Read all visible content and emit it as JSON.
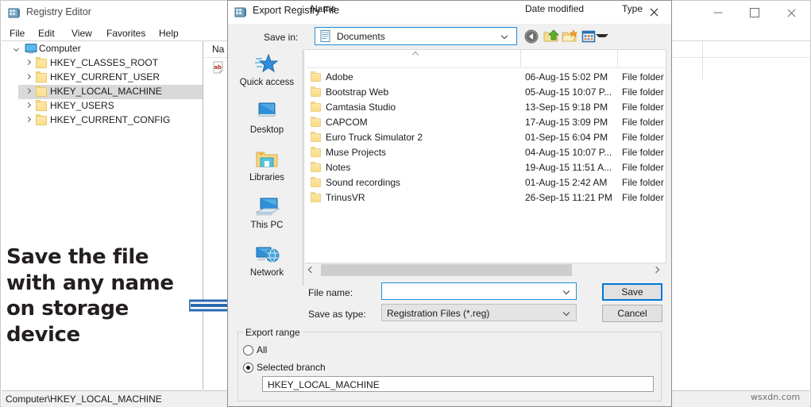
{
  "registry_editor": {
    "title": "Registry Editor",
    "title_icon": "registry-editor-icon",
    "window_controls": {
      "minimize": "minimize-icon",
      "maximize": "maximize-icon",
      "close": "close-icon"
    },
    "menu": [
      "File",
      "Edit",
      "View",
      "Favorites",
      "Help"
    ],
    "tree": {
      "root": {
        "label": "Computer",
        "icon": "computer-icon",
        "expanded": true
      },
      "items": [
        {
          "label": "HKEY_CLASSES_ROOT",
          "selected": false
        },
        {
          "label": "HKEY_CURRENT_USER",
          "selected": false
        },
        {
          "label": "HKEY_LOCAL_MACHINE",
          "selected": true
        },
        {
          "label": "HKEY_USERS",
          "selected": false
        },
        {
          "label": "HKEY_CURRENT_CONFIG",
          "selected": false
        }
      ]
    },
    "value_pane": {
      "column_name": "Na",
      "value_icon": "ab-string-icon"
    },
    "status_bar": "Computer\\HKEY_LOCAL_MACHINE"
  },
  "annotation": {
    "text": "Save the file with any name on storage device",
    "arrow": "right-arrow-annotation",
    "arrow_color": "#2a6bb0"
  },
  "dialog": {
    "title": "Export Registry File",
    "title_icon": "registry-editor-icon",
    "close_label": "close-icon",
    "save_in": {
      "label": "Save in:",
      "value": "Documents",
      "icon": "documents-folder-icon"
    },
    "toolbar": [
      {
        "name": "back-button",
        "icon": "back-arrow-icon"
      },
      {
        "name": "up-one-level-button",
        "icon": "up-folder-icon"
      },
      {
        "name": "new-folder-button",
        "icon": "new-folder-icon"
      },
      {
        "name": "views-button",
        "icon": "views-icon"
      }
    ],
    "places": [
      {
        "label": "Quick access",
        "icon": "quick-access-star-icon"
      },
      {
        "label": "Desktop",
        "icon": "desktop-monitor-icon"
      },
      {
        "label": "Libraries",
        "icon": "libraries-folder-icon"
      },
      {
        "label": "This PC",
        "icon": "this-pc-icon"
      },
      {
        "label": "Network",
        "icon": "network-globe-icon"
      }
    ],
    "file_list": {
      "columns": [
        "Name",
        "Date modified",
        "Type"
      ],
      "sort_indicator": "sort-ascending-icon",
      "rows": [
        {
          "name": "Adobe",
          "date": "06-Aug-15 5:02 PM",
          "type": "File folder"
        },
        {
          "name": "Bootstrap Web",
          "date": "05-Aug-15 10:07 P...",
          "type": "File folder"
        },
        {
          "name": "Camtasia Studio",
          "date": "13-Sep-15 9:18 PM",
          "type": "File folder"
        },
        {
          "name": "CAPCOM",
          "date": "17-Aug-15 3:09 PM",
          "type": "File folder"
        },
        {
          "name": "Euro Truck Simulator 2",
          "date": "01-Sep-15 6:04 PM",
          "type": "File folder"
        },
        {
          "name": "Muse Projects",
          "date": "04-Aug-15 10:07 P...",
          "type": "File folder"
        },
        {
          "name": "Notes",
          "date": "19-Aug-15 11:51 A...",
          "type": "File folder"
        },
        {
          "name": "Sound recordings",
          "date": "01-Aug-15 2:42 AM",
          "type": "File folder"
        },
        {
          "name": "TrinusVR",
          "date": "26-Sep-15 11:21 PM",
          "type": "File folder"
        }
      ]
    },
    "file_name": {
      "label": "File name:",
      "value": "",
      "placeholder": ""
    },
    "save_as_type": {
      "label": "Save as type:",
      "value": "Registration Files (*.reg)"
    },
    "buttons": {
      "save": "Save",
      "cancel": "Cancel"
    },
    "export_range": {
      "legend": "Export range",
      "options": [
        {
          "label": "All",
          "selected": false
        },
        {
          "label": "Selected branch",
          "selected": true
        }
      ],
      "branch_value": "HKEY_LOCAL_MACHINE"
    },
    "accent_color": "#0078d7"
  },
  "watermark": "wsxdn.com"
}
